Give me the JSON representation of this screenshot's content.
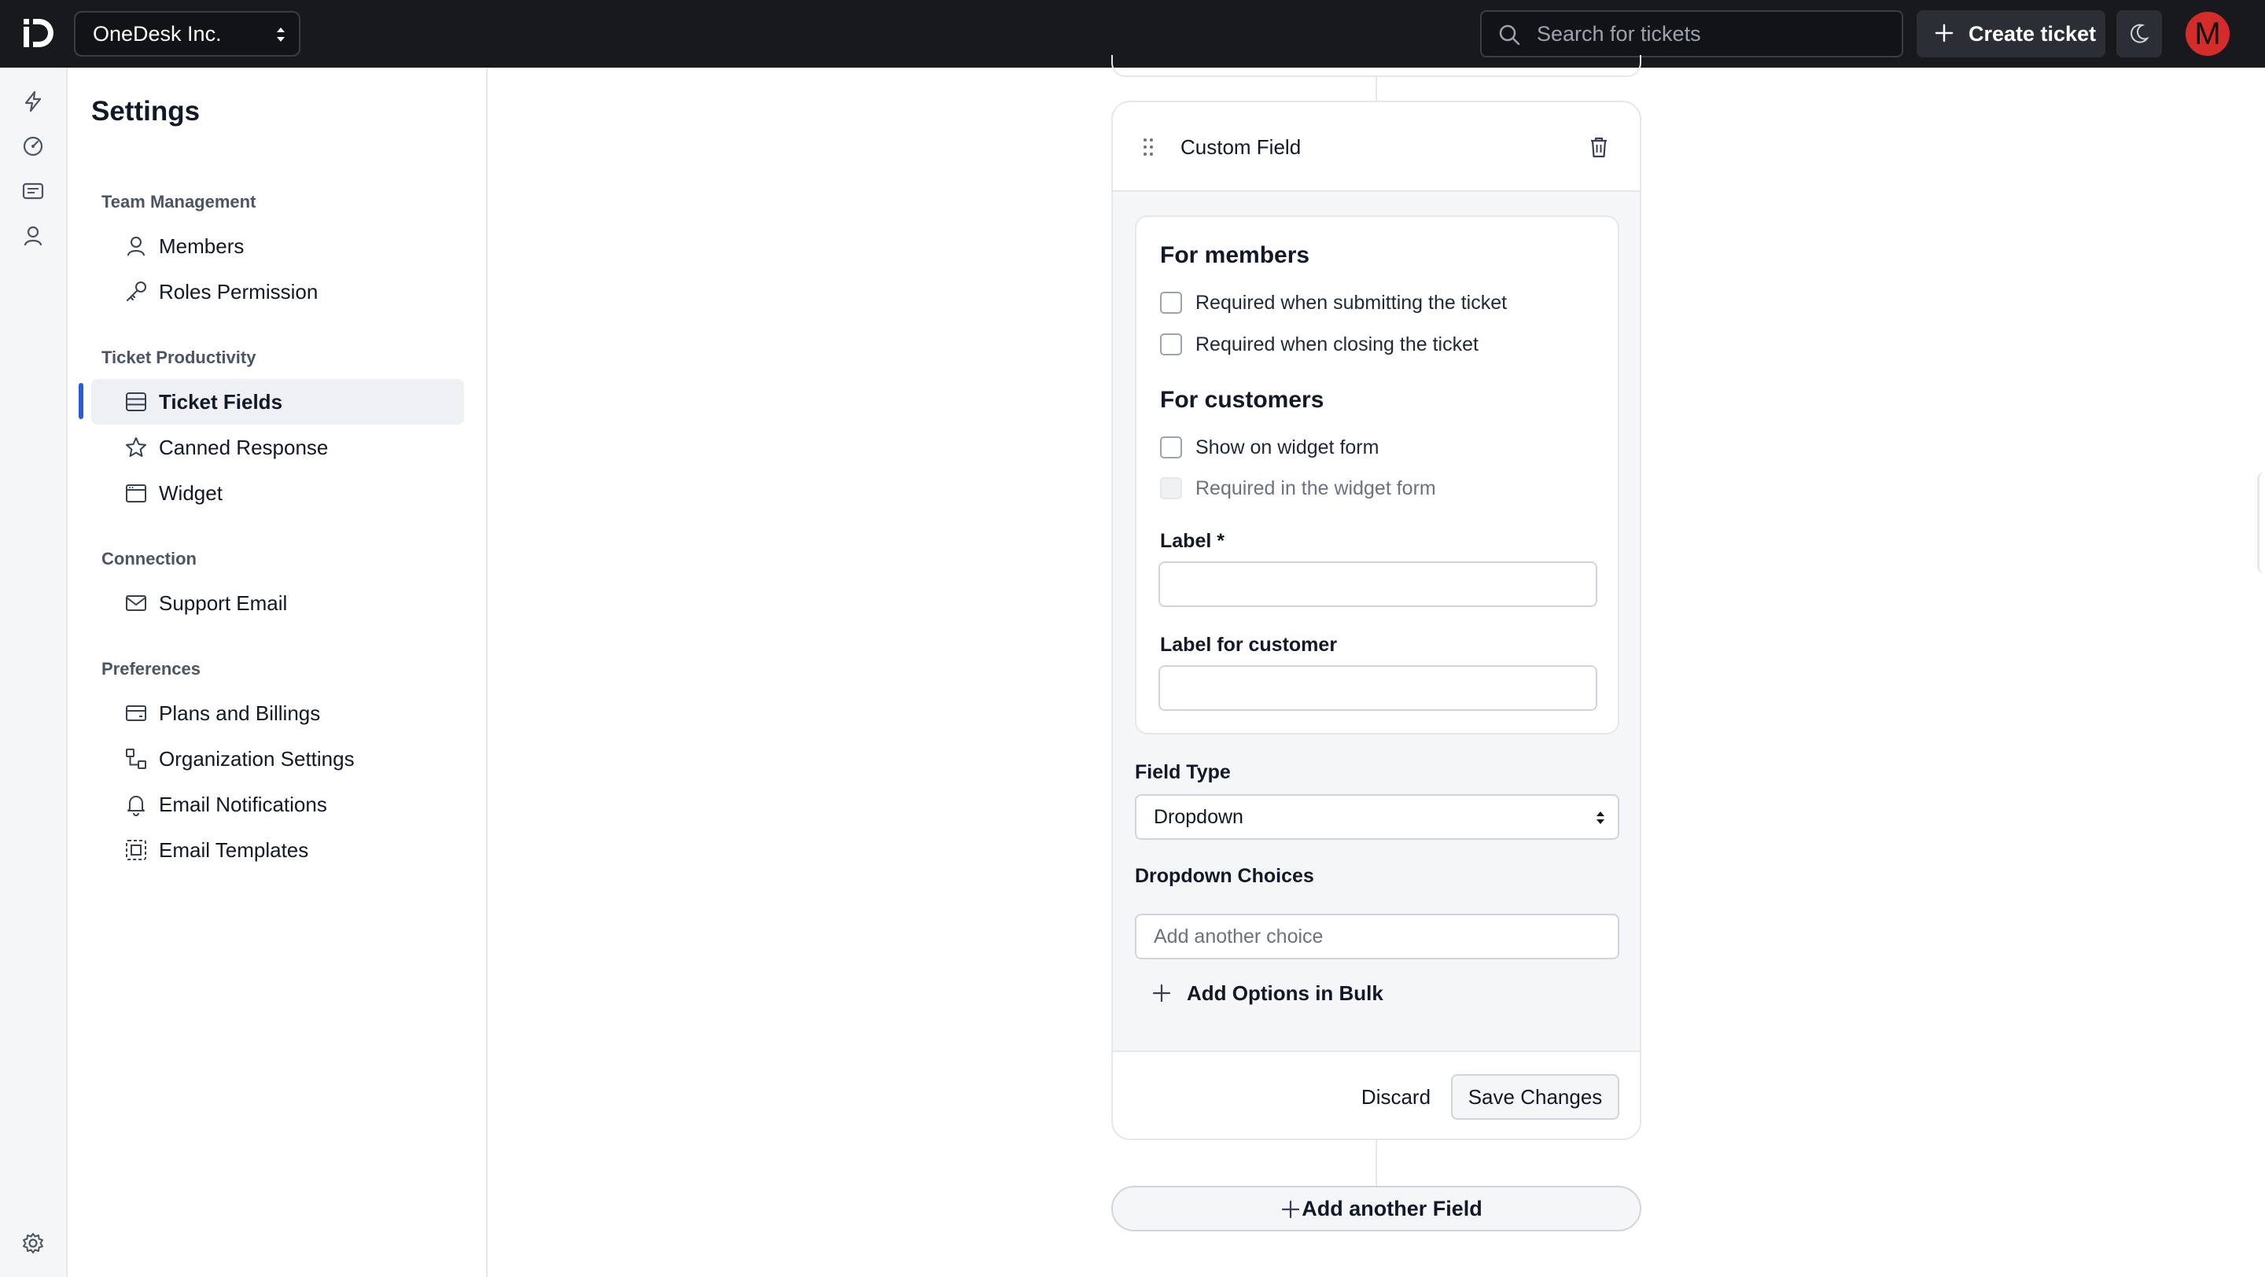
{
  "app": {
    "org_name": "OneDesk Inc.",
    "search_placeholder": "Search for tickets",
    "create_ticket_label": "Create ticket",
    "avatar_initial": "M"
  },
  "sidebar": {
    "title": "Settings",
    "sections": [
      {
        "heading": "Team Management",
        "items": [
          "Members",
          "Roles Permission"
        ]
      },
      {
        "heading": "Ticket Productivity",
        "items": [
          "Ticket Fields",
          "Canned Response",
          "Widget"
        ]
      },
      {
        "heading": "Connection",
        "items": [
          "Support Email"
        ]
      },
      {
        "heading": "Preferences",
        "items": [
          "Plans and Billings",
          "Organization Settings",
          "Email Notifications",
          "Email Templates"
        ]
      }
    ],
    "active_item": "Ticket Fields"
  },
  "field_card": {
    "title": "Custom Field",
    "for_members": {
      "heading": "For members",
      "options": [
        {
          "label": "Required when submitting the ticket",
          "checked": false
        },
        {
          "label": "Required when closing the ticket",
          "checked": false
        }
      ]
    },
    "for_customers": {
      "heading": "For customers",
      "options": [
        {
          "label": "Show on widget form",
          "checked": false
        },
        {
          "label": "Required in the widget form",
          "checked": false,
          "disabled": true
        }
      ]
    },
    "label_field": {
      "label": "Label *",
      "value": ""
    },
    "customer_label_field": {
      "label": "Label for customer",
      "value": ""
    },
    "field_type": {
      "label": "Field Type",
      "value": "Dropdown"
    },
    "dropdown_choices": {
      "label": "Dropdown Choices",
      "placeholder": "Add another choice"
    },
    "add_bulk_label": "Add Options in Bulk",
    "discard_label": "Discard",
    "save_label": "Save Changes"
  },
  "add_field_label": "Add another Field",
  "colors": {
    "topbar": "#17191d",
    "accent": "#2d5bd8",
    "avatar": "#d42b2b"
  }
}
